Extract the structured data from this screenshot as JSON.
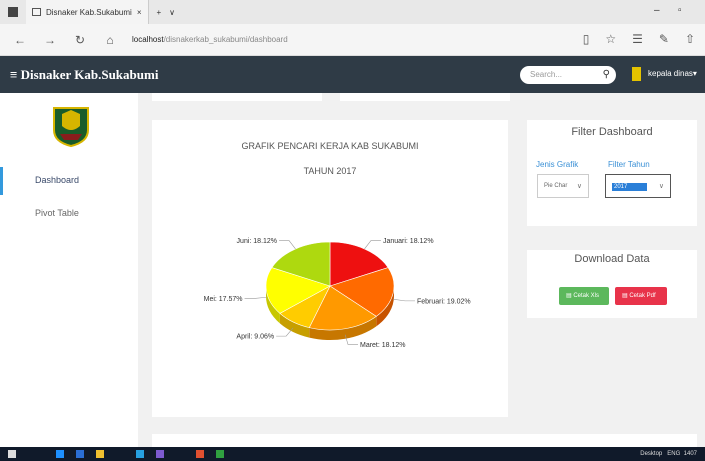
{
  "browser": {
    "tab_title": "Disnaker Kab.Sukabumi",
    "tab_close": "×",
    "new_tab": "+",
    "tab_list": "∨",
    "url_host": "localhost",
    "url_path": "/disnakerkab_sukabumi/dashboard",
    "minimize": "–",
    "maximize": "▫",
    "back": "←",
    "forward": "→",
    "refresh": "↻",
    "home": "⌂",
    "reading": "▯",
    "favorite": "☆",
    "hub": "☰",
    "notes": "✎",
    "share": "⇧"
  },
  "app": {
    "title": "Disnaker Kab.Sukabumi",
    "menu_icon": "≡",
    "search_placeholder": "Search...",
    "search_icon": "⚲",
    "user_label": "kepala dinas",
    "user_caret": "▾"
  },
  "sidebar": {
    "items": [
      {
        "label": "Dashboard",
        "active": true
      },
      {
        "label": "Pivot Table",
        "active": false
      }
    ]
  },
  "chart_data": {
    "type": "pie",
    "title": "GRAFIK PENCARI KERJA KAB SUKABUMI",
    "subtitle": "TAHUN 2017",
    "slices": [
      {
        "label": "Januari: 18.12%",
        "value": 18.12,
        "color": "#ee1010"
      },
      {
        "label": "Februari: 19.02%",
        "value": 19.02,
        "color": "#ff6a00"
      },
      {
        "label": "Maret: 18.12%",
        "value": 18.12,
        "color": "#ff9900"
      },
      {
        "label": "April: 9.06%",
        "value": 9.06,
        "color": "#ffcc00"
      },
      {
        "label": "Mei: 17.57%",
        "value": 17.57,
        "color": "#ffff00"
      },
      {
        "label": "Juni: 18.12%",
        "value": 18.12,
        "color": "#aed90f"
      }
    ]
  },
  "filter": {
    "title": "Filter Dashboard",
    "jenis_label": "Jenis Grafik",
    "jenis_value": "Pie Char",
    "tahun_label": "Filter Tahun",
    "tahun_value": "2017",
    "chevron": "∨"
  },
  "download": {
    "title": "Download Data",
    "xls_label": "Cetak Xls",
    "pdf_label": "Cetak Pdf",
    "xls_color": "#5cb85c",
    "pdf_color": "#e8334a"
  },
  "taskbar": {
    "desktop": "Desktop",
    "lang": "ENG",
    "time": "1407"
  }
}
